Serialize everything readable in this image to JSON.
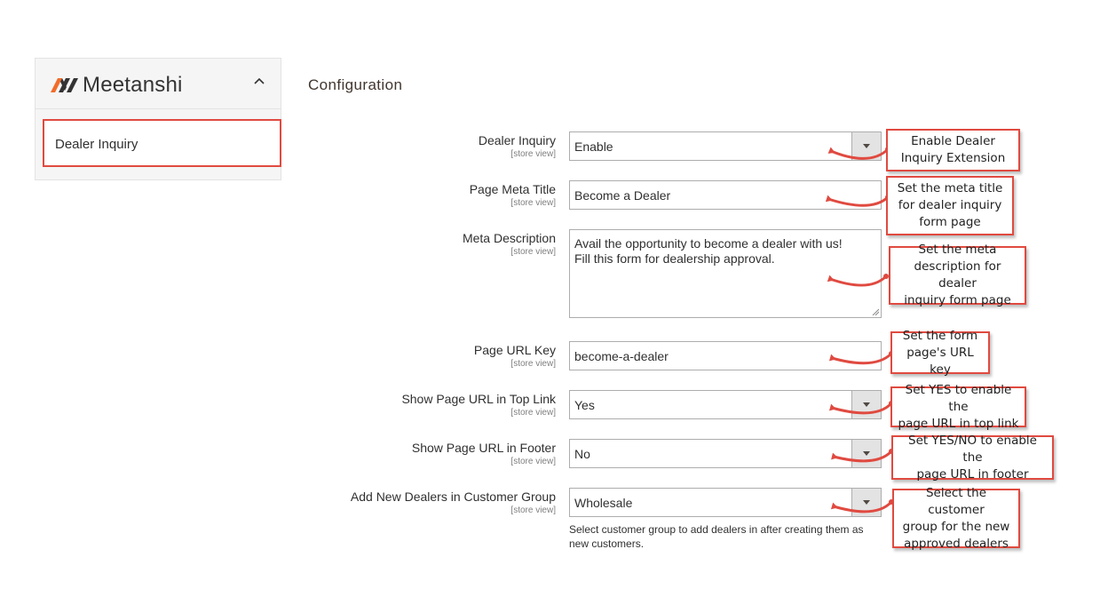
{
  "sidebar": {
    "brand": "Meetanshi",
    "items": [
      {
        "label": "Dealer Inquiry"
      }
    ]
  },
  "main": {
    "title": "Configuration",
    "fields": [
      {
        "label": "Dealer Inquiry",
        "scope": "[store view]",
        "type": "select",
        "value": "Enable"
      },
      {
        "label": "Page Meta Title",
        "scope": "[store view]",
        "type": "input",
        "value": "Become a Dealer"
      },
      {
        "label": "Meta Description",
        "scope": "[store view]",
        "type": "textarea",
        "value_line1": "Avail the opportunity to become a dealer with us!",
        "value_line2": "Fill this form for dealership approval."
      },
      {
        "label": "Page URL Key",
        "scope": "[store view]",
        "type": "input",
        "value": "become-a-dealer"
      },
      {
        "label": "Show Page URL in Top Link",
        "scope": "[store view]",
        "type": "select",
        "value": "Yes"
      },
      {
        "label": "Show Page URL in Footer",
        "scope": "[store view]",
        "type": "select",
        "value": "No"
      },
      {
        "label": "Add New Dealers in Customer Group",
        "scope": "[store view]",
        "type": "select",
        "value": "Wholesale",
        "note_line1": "Select customer group to add dealers in after creating them as",
        "note_line2": "new customers."
      }
    ]
  },
  "callouts": [
    {
      "line1": "Enable Dealer",
      "line2": "Inquiry Extension"
    },
    {
      "line1": "Set the meta title",
      "line2": "for dealer inquiry",
      "line3": "form page"
    },
    {
      "line1": "Set the meta",
      "line2": "description for dealer",
      "line3": "inquiry form page"
    },
    {
      "line1": "Set the form",
      "line2": "page's URL key"
    },
    {
      "line1": "Set YES to enable the",
      "line2": "page URL in top link"
    },
    {
      "line1": "Set YES/NO to enable the",
      "line2": "page URL in footer"
    },
    {
      "line1": "Select the customer",
      "line2": "group for the new",
      "line3": "approved dealers"
    }
  ],
  "colors": {
    "accent": "#e04a40",
    "brand_orange": "#f26c2a",
    "brand_dark": "#333333"
  }
}
